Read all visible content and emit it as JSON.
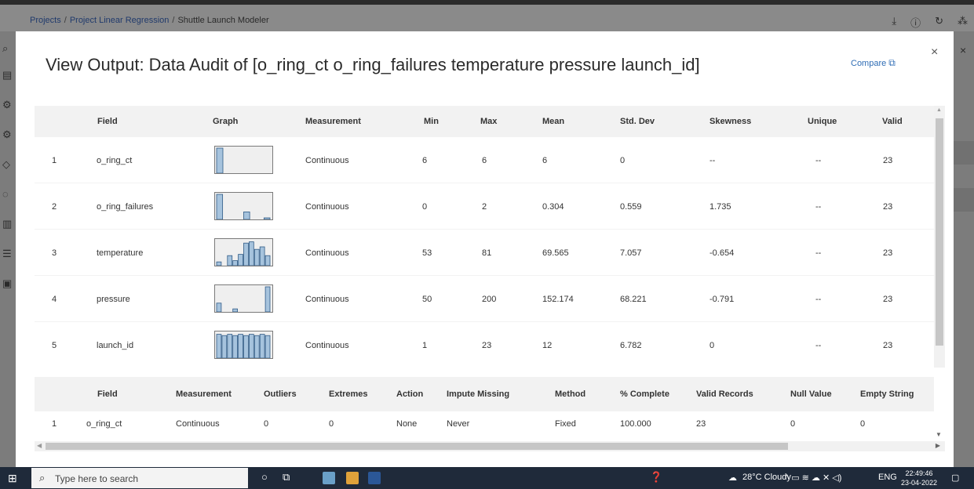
{
  "breadcrumb": {
    "projects": "Projects",
    "project": "Project Linear Regression",
    "current": "Shuttle Launch Modeler"
  },
  "top_icons": [
    "download-icon",
    "info-icon",
    "history-icon",
    "apps-icon"
  ],
  "modal": {
    "title": "View Output: Data Audit of [o_ring_ct o_ring_failures temperature pressure launch_id]",
    "compare_label": "Compare",
    "close_glyph": "×",
    "accent_color": "#2f6db5",
    "bar_color": "#a6c3dd"
  },
  "audit_table": {
    "headers": [
      "Field",
      "Graph",
      "Measurement",
      "Min",
      "Max",
      "Mean",
      "Std. Dev",
      "Skewness",
      "Unique",
      "Valid"
    ],
    "rows": [
      {
        "idx": "1",
        "field": "o_ring_ct",
        "measurement": "Continuous",
        "min": "6",
        "max": "6",
        "mean": "6",
        "std": "0",
        "skew": "--",
        "unique": "--",
        "valid": "23",
        "hist": [
          1.0
        ]
      },
      {
        "idx": "2",
        "field": "o_ring_failures",
        "measurement": "Continuous",
        "min": "0",
        "max": "2",
        "mean": "0.304",
        "std": "0.559",
        "skew": "1.735",
        "unique": "--",
        "valid": "23",
        "hist": [
          1.0,
          0,
          0,
          0,
          0.3,
          0,
          0,
          0.06
        ]
      },
      {
        "idx": "3",
        "field": "temperature",
        "measurement": "Continuous",
        "min": "53",
        "max": "81",
        "mean": "69.565",
        "std": "7.057",
        "skew": "-0.654",
        "unique": "--",
        "valid": "23",
        "hist": [
          0.15,
          0,
          0.4,
          0.2,
          0.45,
          0.9,
          0.95,
          0.65,
          0.75,
          0.4
        ]
      },
      {
        "idx": "4",
        "field": "pressure",
        "measurement": "Continuous",
        "min": "50",
        "max": "200",
        "mean": "152.174",
        "std": "68.221",
        "skew": "-0.791",
        "unique": "--",
        "valid": "23",
        "hist": [
          0.35,
          0,
          0,
          0.12,
          0,
          0,
          0,
          0,
          0,
          1.0
        ]
      },
      {
        "idx": "5",
        "field": "launch_id",
        "measurement": "Continuous",
        "min": "1",
        "max": "23",
        "mean": "12",
        "std": "6.782",
        "skew": "0",
        "unique": "--",
        "valid": "23",
        "hist": [
          0.95,
          0.9,
          0.95,
          0.9,
          0.95,
          0.9,
          0.95,
          0.9,
          0.95,
          0.9
        ]
      }
    ]
  },
  "quality_table": {
    "headers": [
      "Field",
      "Measurement",
      "Outliers",
      "Extremes",
      "Action",
      "Impute Missing",
      "Method",
      "% Complete",
      "Valid Records",
      "Null Value",
      "Empty String"
    ],
    "rows": [
      {
        "idx": "1",
        "field": "o_ring_ct",
        "measurement": "Continuous",
        "outliers": "0",
        "extremes": "0",
        "action": "None",
        "impute": "Never",
        "method": "Fixed",
        "complete": "100.000",
        "valid_records": "23",
        "null_value": "0",
        "empty_string": "0"
      }
    ]
  },
  "taskbar": {
    "search_placeholder": "Type here to search",
    "weather": "28°C  Cloudy",
    "language": "ENG",
    "time": "22:49:46",
    "date": "23-04-2022"
  }
}
